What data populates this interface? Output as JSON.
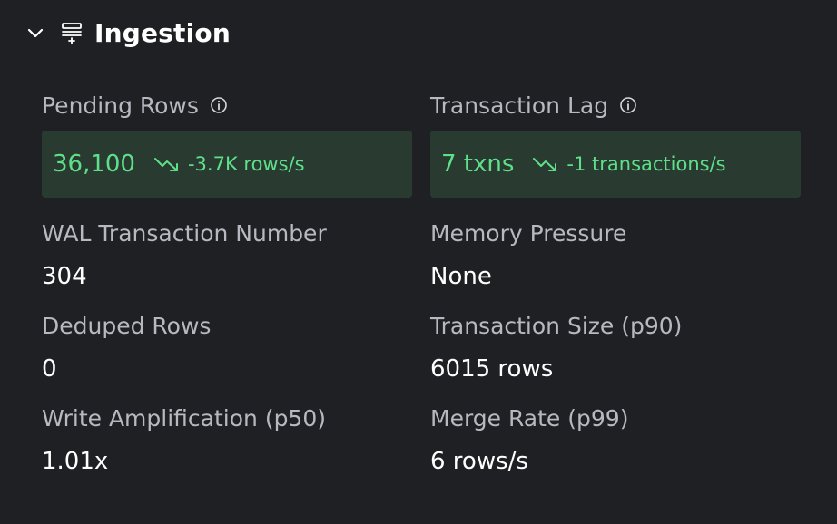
{
  "section": {
    "title": "Ingestion",
    "toggle_icon": "chevron-down-icon",
    "icon": "stack-add-icon"
  },
  "metrics": {
    "pending_rows": {
      "label": "Pending Rows",
      "value": "36,100",
      "trend": "-3.7K rows/s",
      "trend_direction": "down"
    },
    "transaction_lag": {
      "label": "Transaction Lag",
      "value": "7 txns",
      "trend": "-1 transactions/s",
      "trend_direction": "down"
    },
    "wal_transaction_number": {
      "label": "WAL Transaction Number",
      "value": "304"
    },
    "memory_pressure": {
      "label": "Memory Pressure",
      "value": "None"
    },
    "deduped_rows": {
      "label": "Deduped Rows",
      "value": "0"
    },
    "transaction_size": {
      "label": "Transaction Size (p90)",
      "value": "6015 rows"
    },
    "write_amplification": {
      "label": "Write Amplification (p50)",
      "value": "1.01x"
    },
    "merge_rate": {
      "label": "Merge Rate (p99)",
      "value": "6 rows/s"
    }
  },
  "colors": {
    "background": "#1f2024",
    "highlight_bg": "#293b30",
    "positive_green": "#5ee08a",
    "label_gray": "#b6b9c0"
  }
}
